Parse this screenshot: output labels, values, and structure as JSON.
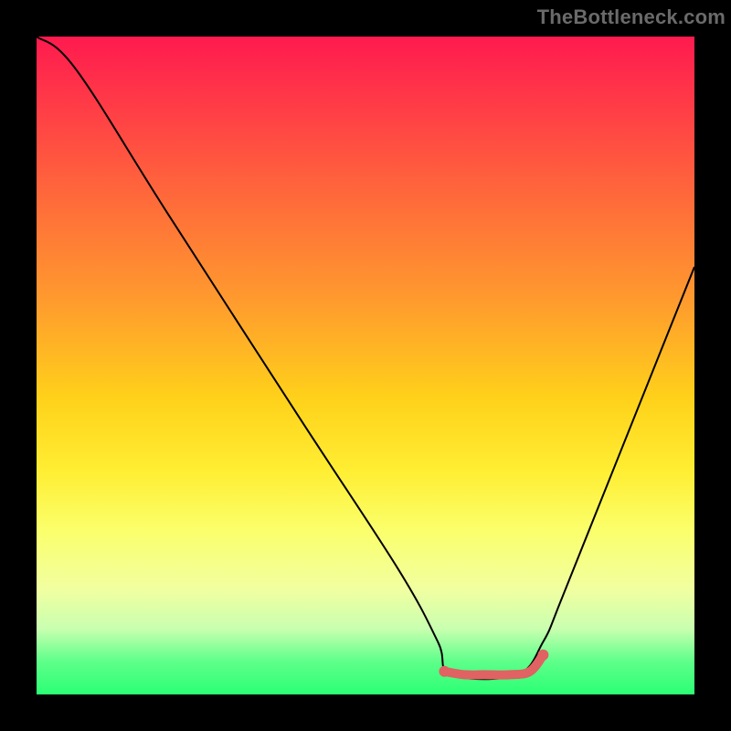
{
  "watermark": "TheBottleneck.com",
  "chart_data": {
    "type": "line",
    "title": "",
    "xlabel": "",
    "ylabel": "",
    "xlim": [
      0,
      100
    ],
    "ylim": [
      0,
      100
    ],
    "grid": false,
    "legend": false,
    "series": [
      {
        "name": "bottleneck-curve",
        "x": [
          0,
          6,
          20,
          40,
          55,
          61,
          63,
          73,
          77,
          80,
          88,
          100
        ],
        "y": [
          100,
          95,
          73,
          42,
          19,
          8,
          3,
          3,
          8,
          15,
          35,
          65
        ],
        "color": "#000000",
        "line_width": 2
      },
      {
        "name": "highlight-band",
        "x": [
          62,
          65,
          68,
          72,
          75,
          77
        ],
        "y": [
          3.5,
          3,
          3,
          3,
          3.5,
          6
        ],
        "color": "#e06262",
        "line_width": 10
      }
    ]
  }
}
